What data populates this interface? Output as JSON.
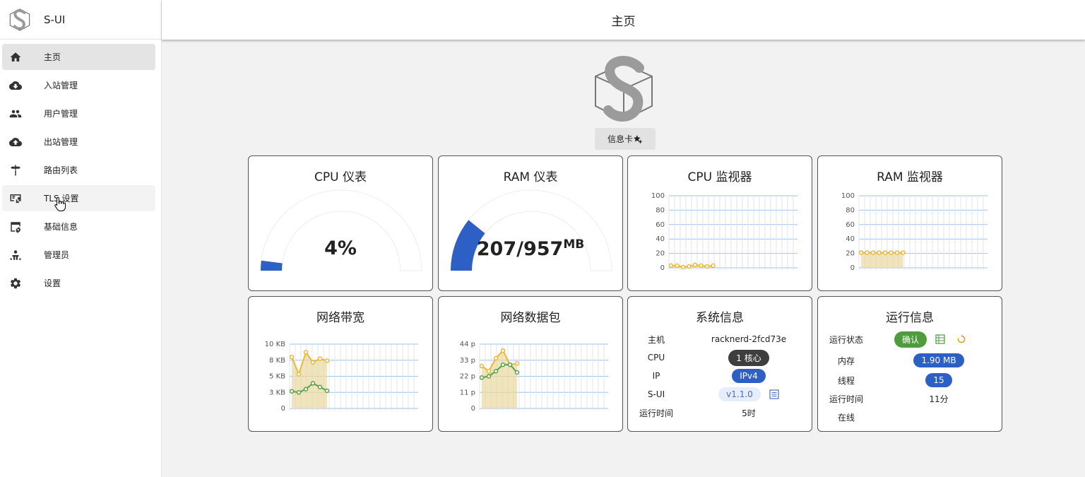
{
  "app": {
    "name": "S-UI"
  },
  "topbar": {
    "title": "主页"
  },
  "sidebar": {
    "items": [
      {
        "label": "主页",
        "icon": "home-icon",
        "active": true
      },
      {
        "label": "入站管理",
        "icon": "cloud-download-icon"
      },
      {
        "label": "用户管理",
        "icon": "users-icon"
      },
      {
        "label": "出站管理",
        "icon": "cloud-upload-icon"
      },
      {
        "label": "路由列表",
        "icon": "signpost-icon"
      },
      {
        "label": "TLS 设置",
        "icon": "certificate-icon",
        "hover": true
      },
      {
        "label": "基础信息",
        "icon": "settings-window-icon"
      },
      {
        "label": "管理员",
        "icon": "admin-icon"
      },
      {
        "label": "设置",
        "icon": "gear-icon"
      }
    ]
  },
  "info_button": {
    "label": "信息卡"
  },
  "cards": {
    "cpu_gauge": {
      "title": "CPU 仪表",
      "value_text": "4%",
      "percent": 4
    },
    "ram_gauge": {
      "title": "RAM 仪表",
      "value_text": "207/957",
      "unit": "MB",
      "percent": 21.6
    },
    "cpu_monitor": {
      "title": "CPU 监视器"
    },
    "ram_monitor": {
      "title": "RAM 监视器"
    },
    "network_bandwidth": {
      "title": "网络带宽"
    },
    "network_packets": {
      "title": "网络数据包"
    },
    "system_info": {
      "title": "系统信息",
      "rows": [
        {
          "key": "主机",
          "value": "racknerd-2fcd73e"
        },
        {
          "key": "CPU",
          "value": "1 核心"
        },
        {
          "key": "IP",
          "value": "IPv4"
        },
        {
          "key": "S-UI",
          "value": "v1.1.0"
        },
        {
          "key": "运行时间",
          "value": "5时"
        }
      ]
    },
    "run_info": {
      "title": "运行信息",
      "rows": [
        {
          "key": "运行状态",
          "value": "确认"
        },
        {
          "key": "内存",
          "value": "1.90 MB"
        },
        {
          "key": "线程",
          "value": "15"
        },
        {
          "key": "运行时间",
          "value": "11分"
        },
        {
          "key": "在线",
          "value": ""
        }
      ]
    }
  },
  "chart_data": [
    {
      "type": "area",
      "title": "CPU 监视器",
      "yticks": [
        "100",
        "80",
        "60",
        "40",
        "20",
        "0"
      ],
      "ylim": [
        0,
        100
      ],
      "series": [
        {
          "values": [
            3,
            3,
            1,
            2,
            4,
            3,
            2,
            3
          ],
          "color": "#e8b93a"
        }
      ]
    },
    {
      "type": "area",
      "title": "RAM 监视器",
      "yticks": [
        "100",
        "80",
        "60",
        "40",
        "20",
        "0"
      ],
      "ylim": [
        0,
        100
      ],
      "series": [
        {
          "values": [
            21,
            21,
            21,
            21,
            21,
            21,
            21,
            21
          ],
          "color": "#e8b93a"
        }
      ]
    },
    {
      "type": "area",
      "title": "网络带宽",
      "yticks": [
        "10 KB",
        "8 KB",
        "5 KB",
        "3 KB",
        "0"
      ],
      "ylim": [
        0,
        12
      ],
      "series": [
        {
          "values": [
            9.6,
            6.4,
            10.5,
            8.6,
            9.3,
            8.9
          ],
          "color": "#e8b93a"
        },
        {
          "values": [
            3.2,
            3.0,
            3.6,
            4.7,
            4.0,
            3.3
          ],
          "color": "#5aa14a"
        }
      ]
    },
    {
      "type": "area",
      "title": "网络数据包",
      "yticks": [
        "44 p",
        "33 p",
        "22 p",
        "11 p",
        "0"
      ],
      "ylim": [
        0,
        50
      ],
      "series": [
        {
          "values": [
            33,
            29,
            39,
            45,
            34,
            35
          ],
          "color": "#e8b93a"
        },
        {
          "values": [
            24,
            25,
            29,
            34,
            34,
            28
          ],
          "color": "#5aa14a"
        }
      ]
    }
  ]
}
